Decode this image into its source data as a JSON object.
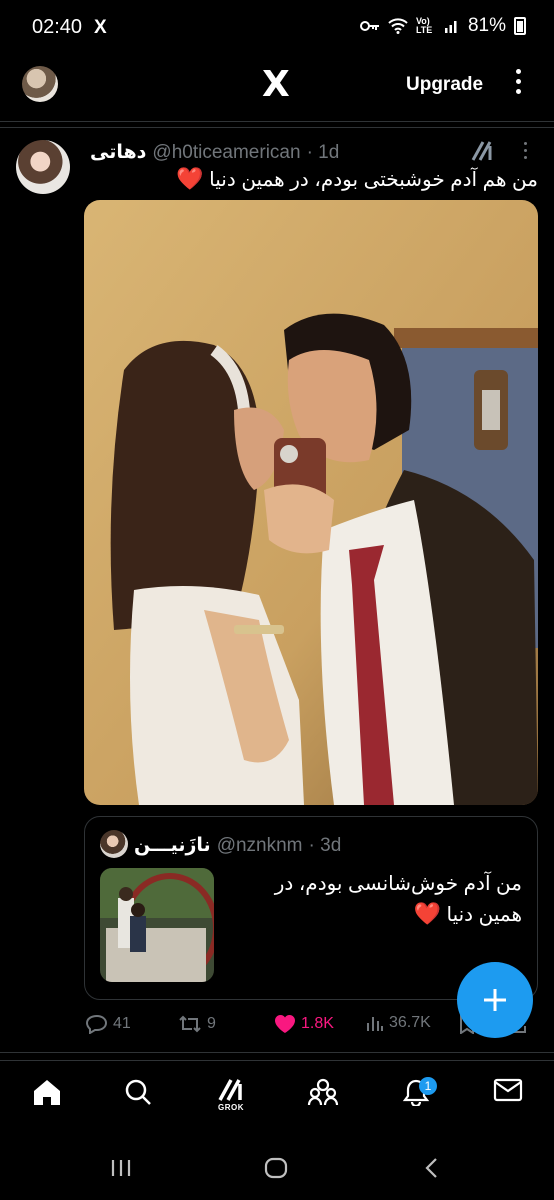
{
  "status_bar": {
    "time": "02:40",
    "x_icon": "X",
    "signal_text": "Vo) LTE",
    "battery": "81%"
  },
  "top_bar": {
    "logo": "X",
    "upgrade_label": "Upgrade"
  },
  "tweet": {
    "display_name": "دهاتی",
    "handle": "@h0ticeamerican",
    "time": "· 1d",
    "text": "من هم آدم خوشبختی بودم، در همین دنیا",
    "heart": "❤️",
    "actions": {
      "replies": "41",
      "reposts": "9",
      "likes": "1.8K",
      "views": "36.7K"
    }
  },
  "quote": {
    "display_name": "نازَنیـــن",
    "handle": "@nznknm",
    "time": "· 3d",
    "text": "من آدم خوش‌شانسی بودم، در همین دنیا",
    "heart": "❤️"
  },
  "bottom_nav": {
    "items": [
      "home-icon",
      "search-icon",
      "grok-icon",
      "communities-icon",
      "notifications-icon",
      "messages-icon"
    ],
    "grok_label": "GROK",
    "notifications_badge": "1"
  },
  "colors": {
    "accent": "#1d9bf0",
    "like": "#f91880",
    "muted": "#71767b",
    "background": "#000000"
  }
}
